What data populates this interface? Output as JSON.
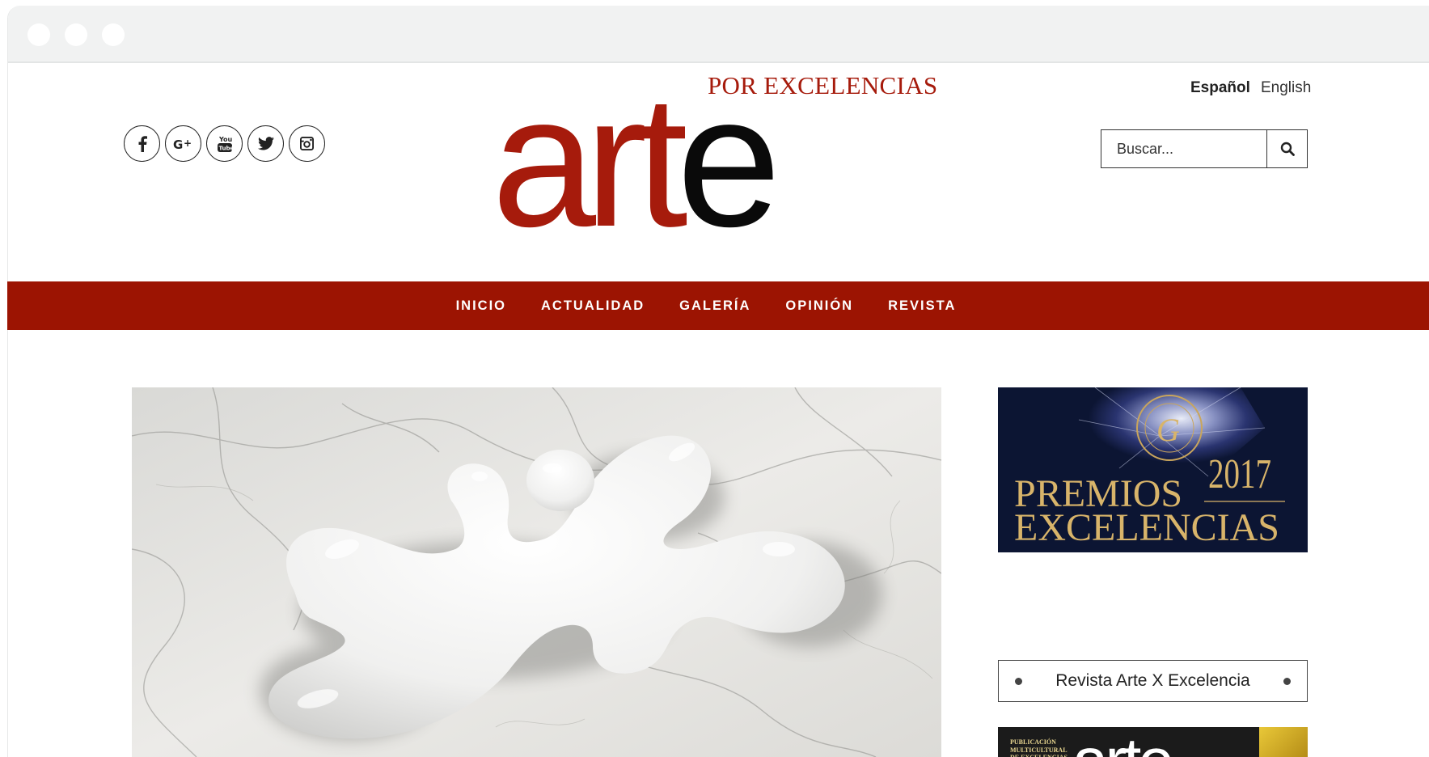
{
  "logo": {
    "top_text": "POR EXCELENCIAS",
    "main_red": "art",
    "main_black": "e"
  },
  "languages": [
    "Español",
    "English"
  ],
  "search": {
    "placeholder": "Buscar..."
  },
  "social_icons": [
    "facebook-icon",
    "google-plus-icon",
    "youtube-icon",
    "twitter-icon",
    "instagram-icon"
  ],
  "nav": {
    "items": [
      "INICIO",
      "ACTUALIDAD",
      "GALERÍA",
      "OPINIÓN",
      "REVISTA"
    ]
  },
  "sidebar": {
    "banner": {
      "line1": "PREMIOS",
      "line2": "EXCELENCIAS",
      "year": "2017"
    },
    "revista_title": "Revista Arte X Excelencia",
    "magazine_cover": {
      "publisher_text": "PUBLICACIÓN\nMULTICULTURAL\nDE EXCELENCIAS",
      "title": "arte"
    }
  },
  "colors": {
    "brand_red": "#9c1402",
    "logo_red": "#a61b0c",
    "banner_gold": "#d8b46a"
  }
}
